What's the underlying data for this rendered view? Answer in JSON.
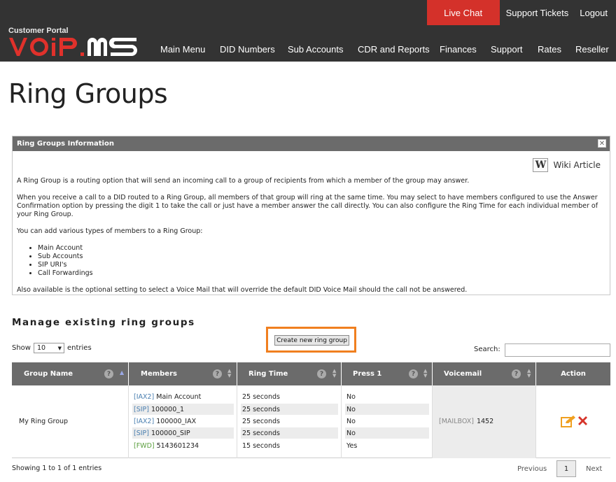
{
  "header": {
    "live_chat": "Live Chat",
    "support_tickets": "Support Tickets",
    "logout": "Logout",
    "logo_subtitle": "Customer Portal",
    "logo_text": "VOiP.MS",
    "nav": [
      "Main Menu",
      "DID Numbers",
      "Sub Accounts",
      "CDR and Reports",
      "Finances",
      "Support",
      "Rates",
      "Reseller"
    ]
  },
  "page_title": "Ring Groups",
  "info_panel": {
    "title": "Ring Groups Information",
    "close": "✕",
    "wiki_icon": "W",
    "wiki_label": "Wiki Article",
    "p1": "A Ring Group is a routing option that will send an incoming call to a group of recipients from which a member of the group may answer.",
    "p2": "When you receive a call to a DID routed to a Ring Group, all members of that group will ring at the same time. You may select to have members configured to use the Answer Confirmation option by pressing the digit 1 to take the call or just have a member answer the call directly. You can also configure the Ring Time for each individual member of your Ring Group.",
    "p3": "You can add various types of members to a Ring Group:",
    "member_types": [
      "Main Account",
      "Sub Accounts",
      "SIP URI's",
      "Call Forwardings"
    ],
    "p4": "Also available is the optional setting to select a Voice Mail that will override the default DID Voice Mail should the call not be answered."
  },
  "manage": {
    "heading": "Manage existing ring groups",
    "create_button": "Create new ring group",
    "show_label": "Show",
    "show_value": "10",
    "entries_label": "entries",
    "search_label": "Search:",
    "search_value": ""
  },
  "table": {
    "columns": [
      "Group Name",
      "Members",
      "Ring Time",
      "Press 1",
      "Voicemail",
      "Action"
    ],
    "help_glyph": "?",
    "rows": [
      {
        "group_name": "My Ring Group",
        "members": [
          {
            "tag": "[IAX2]",
            "name": "Main Account",
            "ring_time": "25 seconds",
            "press1": "No"
          },
          {
            "tag": "[SIP]",
            "name": "100000_1",
            "ring_time": "25 seconds",
            "press1": "No"
          },
          {
            "tag": "[IAX2]",
            "name": "100000_IAX",
            "ring_time": "25 seconds",
            "press1": "No"
          },
          {
            "tag": "[SIP]",
            "name": "100000_SIP",
            "ring_time": "25 seconds",
            "press1": "No"
          },
          {
            "tag": "[FWD]",
            "name": "5143601234",
            "ring_time": "15 seconds",
            "press1": "Yes"
          }
        ],
        "voicemail_tag": "[MAILBOX]",
        "voicemail_value": "1452"
      }
    ]
  },
  "footer": {
    "showing": "Showing 1 to 1 of 1 entries",
    "previous": "Previous",
    "page": "1",
    "next": "Next"
  },
  "colors": {
    "header_bg": "#333333",
    "live_chat_bg": "#d4312a",
    "logo_red": "#e0312b",
    "table_header_bg": "#6b6b6b",
    "highlight_orange": "#f07f1f",
    "edit_icon": "#f0a020",
    "delete_icon": "#d6342a"
  },
  "icons": {
    "edit": "edit-icon",
    "delete": "delete-icon",
    "wiki": "wikipedia-icon",
    "close": "close-icon"
  }
}
